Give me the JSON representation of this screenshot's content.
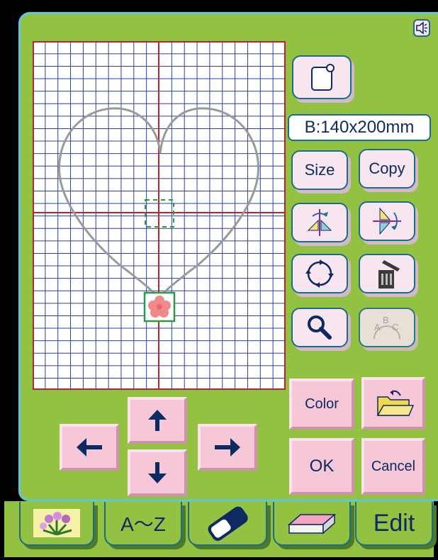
{
  "dimension_readout": "B:140x200mm",
  "buttons": {
    "size": "Size",
    "copy": "Copy",
    "color": "Color",
    "ok": "OK",
    "cancel": "Cancel"
  },
  "tabs": [
    {
      "label": "",
      "icon": "flower-pattern-icon"
    },
    {
      "label": "A～Z",
      "icon": ""
    },
    {
      "label": "",
      "icon": "eraser-icon"
    },
    {
      "label": "",
      "icon": "hoop-icon"
    },
    {
      "label": "Edit",
      "icon": ""
    }
  ],
  "colors": {
    "panel": "#93c142",
    "panel_border": "#5cc8de",
    "button_face": "#f7e6f0",
    "arrow_button": "#f6c7d7",
    "grid_line": "#2d3f9e",
    "center_line": "#c0222a",
    "text": "#0d2a63"
  }
}
